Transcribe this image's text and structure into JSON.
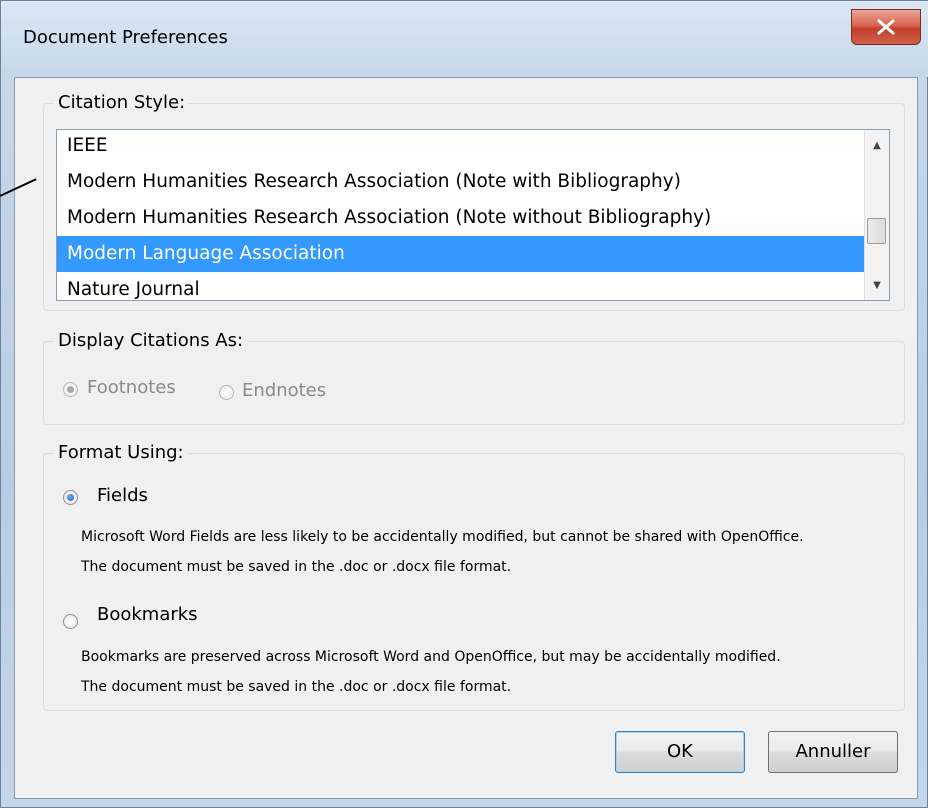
{
  "window": {
    "title": "Document Preferences"
  },
  "citation_style": {
    "legend": "Citation Style:",
    "items": [
      {
        "label": "IEEE",
        "selected": false
      },
      {
        "label": "Modern Humanities Research Association (Note with Bibliography)",
        "selected": false
      },
      {
        "label": "Modern Humanities Research Association (Note without Bibliography)",
        "selected": false
      },
      {
        "label": "Modern Language Association",
        "selected": true
      },
      {
        "label": "Nature Journal",
        "selected": false
      }
    ]
  },
  "display_citations": {
    "legend": "Display Citations As:",
    "options": [
      {
        "label": "Footnotes",
        "checked": true,
        "disabled": true
      },
      {
        "label": "Endnotes",
        "checked": false,
        "disabled": true
      }
    ]
  },
  "format_using": {
    "legend": "Format Using:",
    "fields": {
      "label": "Fields",
      "checked": true,
      "desc1": "Microsoft Word Fields are less likely to be accidentally modified, but cannot be shared with OpenOffice.",
      "desc2": "The document must be saved in the .doc or .docx file format."
    },
    "bookmarks": {
      "label": "Bookmarks",
      "checked": false,
      "desc1": "Bookmarks are preserved across Microsoft Word and OpenOffice, but may be accidentally modified.",
      "desc2": "The document must be saved in the .doc or .docx file format."
    }
  },
  "buttons": {
    "ok": "OK",
    "cancel": "Annuller"
  },
  "colors": {
    "selection": "#3399ff",
    "dialog_bg": "#f0f0f0",
    "close_button": "#c03d2a"
  }
}
